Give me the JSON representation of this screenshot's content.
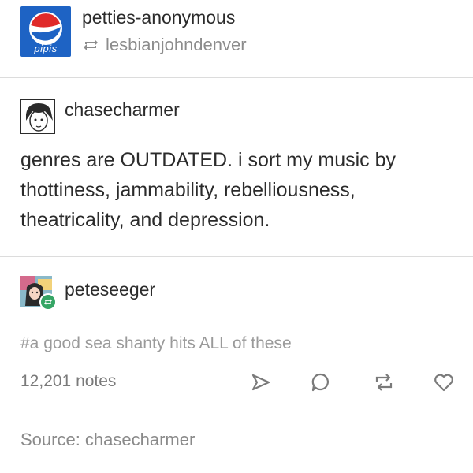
{
  "reblog_header": {
    "blog_name": "petties-anonymous",
    "reblogged_from": "lesbianjohndenver",
    "avatar_text": "pipis"
  },
  "original_post": {
    "username": "chasecharmer",
    "body": "genres are OUTDATED. i sort my music by thottiness, jammability, rebelliousness, theatricality, and depression."
  },
  "reblog": {
    "username": "peteseeger",
    "tags": "#a good sea shanty hits ALL of these"
  },
  "footer": {
    "notes": "12,201 notes",
    "source": "Source: chasecharmer"
  },
  "icons": {
    "share": "share-icon",
    "reply": "reply-icon",
    "reblog": "reblog-icon",
    "like": "heart-icon"
  },
  "colors": {
    "pipis_blue": "#1e63c4",
    "pipis_red": "#e02a2a",
    "reblog_green": "#35a565"
  }
}
